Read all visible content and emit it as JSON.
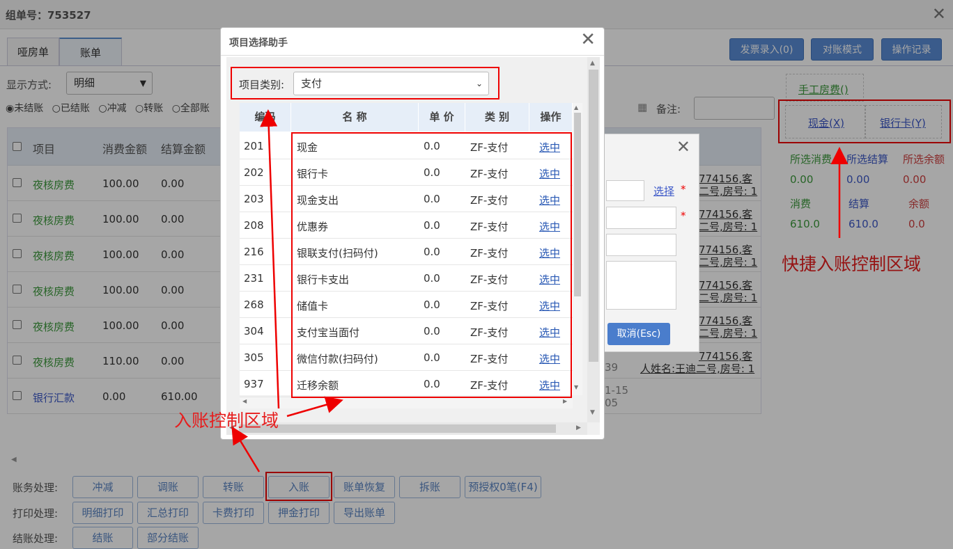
{
  "window": {
    "title": "组单号：753527"
  },
  "tabs": [
    {
      "label": "哑房单"
    },
    {
      "label": "账单"
    }
  ],
  "top_buttons": [
    {
      "label": "发票录入(0)"
    },
    {
      "label": "对账模式"
    },
    {
      "label": "操作记录"
    }
  ],
  "filters": {
    "display_label": "显示方式:",
    "display_value": "明细",
    "status_radios": [
      {
        "label": "未结账",
        "checked": true
      },
      {
        "label": "已结账"
      },
      {
        "label": "冲减"
      },
      {
        "label": "转账"
      },
      {
        "label": "全部账"
      }
    ],
    "remark_label": "备注:"
  },
  "grid": {
    "headers": [
      "项目",
      "消费金额",
      "结算金额"
    ],
    "rows": [
      {
        "item": "夜核房费",
        "consume": "100.00",
        "settle": "0.00"
      },
      {
        "item": "夜核房费",
        "consume": "100.00",
        "settle": "0.00"
      },
      {
        "item": "夜核房费",
        "consume": "100.00",
        "settle": "0.00"
      },
      {
        "item": "夜核房费",
        "consume": "100.00",
        "settle": "0.00"
      },
      {
        "item": "夜核房费",
        "consume": "100.00",
        "settle": "0.00"
      },
      {
        "item": "夜核房费",
        "consume": "110.00",
        "settle": "0.00"
      },
      {
        "item": "银行汇款",
        "consume": "0.00",
        "settle": "610.00"
      }
    ],
    "remark_fragments": [
      {
        "l1": "774156,客",
        "l2": "二号,房号: 1"
      },
      {
        "l1": "774156,客",
        "l2": "二号,房号: 1"
      },
      {
        "l1": "774156,客",
        "l2": "二号,房号: 1"
      },
      {
        "l1": "774156,客",
        "l2": "二号,房号: 1"
      },
      {
        "l1": "774156,客",
        "l2": "二号,房号: 1"
      },
      {
        "l1": "774156,客",
        "l2": "人姓名:王迪二号,房号: 1"
      }
    ],
    "misc_fragments": {
      "f1": "39",
      "f2": "1-15",
      "f3": "05"
    }
  },
  "quick": {
    "manual_fee": "手工房费()",
    "cash": "现金(X)",
    "bank_card": "银行卡(Y)",
    "stats": {
      "labels1": [
        "所选消费",
        "所选结算",
        "所选余额"
      ],
      "values1": [
        "0.00",
        "0.00",
        "0.00"
      ],
      "labels2": [
        "消费",
        "结算",
        "余额"
      ],
      "values2": [
        "610.0",
        "610.0",
        "0.0"
      ]
    }
  },
  "bottom": {
    "account_label": "账务处理:",
    "account_buttons": [
      "冲减",
      "调账",
      "转账",
      "入账",
      "账单恢复",
      "拆账",
      "预授权0笔(F4)"
    ],
    "print_label": "打印处理:",
    "print_buttons": [
      "明细打印",
      "汇总打印",
      "卡费打印",
      "押金打印",
      "导出账单"
    ],
    "settle_label": "结账处理:",
    "settle_buttons": [
      "结账",
      "部分结账"
    ]
  },
  "second_dialog": {
    "choose_link": "选择",
    "required_mark": "*",
    "cancel_button": "取消(Esc)"
  },
  "dialog": {
    "title": "项目选择助手",
    "category_label": "项目类别:",
    "category_value": "支付",
    "table_headers": [
      "编码",
      "名 称",
      "单 价",
      "类 别",
      "操作"
    ],
    "rows": [
      {
        "code": "201",
        "name": "现金",
        "price": "0.0",
        "type": "ZF-支付",
        "op": "选中"
      },
      {
        "code": "202",
        "name": "银行卡",
        "price": "0.0",
        "type": "ZF-支付",
        "op": "选中"
      },
      {
        "code": "203",
        "name": "现金支出",
        "price": "0.0",
        "type": "ZF-支付",
        "op": "选中"
      },
      {
        "code": "208",
        "name": "优惠券",
        "price": "0.0",
        "type": "ZF-支付",
        "op": "选中"
      },
      {
        "code": "216",
        "name": "银联支付(扫码付)",
        "price": "0.0",
        "type": "ZF-支付",
        "op": "选中"
      },
      {
        "code": "231",
        "name": "银行卡支出",
        "price": "0.0",
        "type": "ZF-支付",
        "op": "选中"
      },
      {
        "code": "268",
        "name": "储值卡",
        "price": "0.0",
        "type": "ZF-支付",
        "op": "选中"
      },
      {
        "code": "304",
        "name": "支付宝当面付",
        "price": "0.0",
        "type": "ZF-支付",
        "op": "选中"
      },
      {
        "code": "305",
        "name": "微信付款(扫码付)",
        "price": "0.0",
        "type": "ZF-支付",
        "op": "选中"
      },
      {
        "code": "937",
        "name": "迁移余额",
        "price": "0.0",
        "type": "ZF-支付",
        "op": "选中"
      }
    ]
  },
  "annotations": {
    "entry_area": "入账控制区域",
    "quick_area": "快捷入账控制区域"
  },
  "colors": {
    "annotation_red": "#e00000",
    "accent_blue": "#5a8dd6"
  }
}
